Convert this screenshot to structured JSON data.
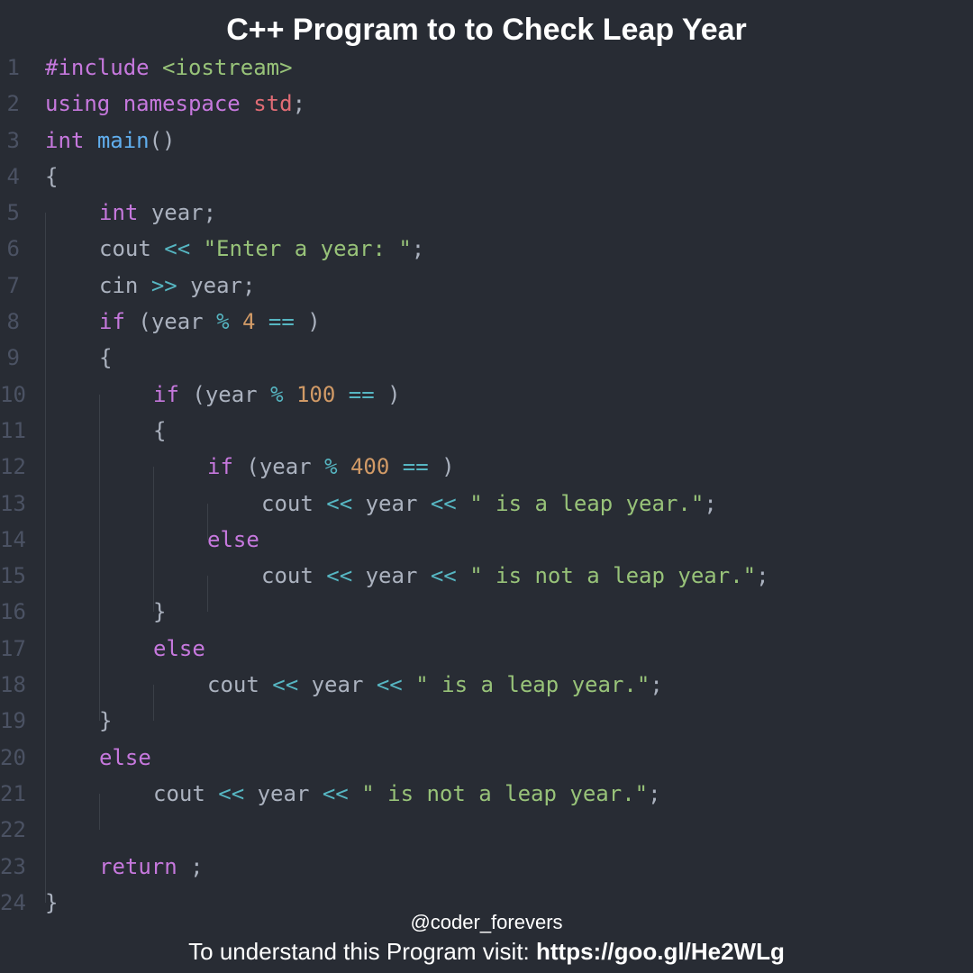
{
  "title": "C++ Program to to Check Leap Year",
  "handle": "@coder_forevers",
  "footer_prefix": "To understand this Program visit: ",
  "footer_link": "https://goo.gl/He2WLg",
  "lines": {
    "l1": {
      "pre": "#include",
      "inc": "<iostream>"
    },
    "l2": {
      "kw1": "using",
      "kw2": "namespace",
      "id": "std",
      "sc": ";"
    },
    "l3": {
      "type": "int",
      "fn": "main",
      "paren": "()"
    },
    "l4": {
      "brace": "{"
    },
    "l5": {
      "type": "int",
      "id": "year",
      "sc": ";"
    },
    "l6": {
      "id": "cout",
      "op": "<<",
      "str": "\"Enter a year: \"",
      "sc": ";"
    },
    "l7": {
      "id1": "cin",
      "op": ">>",
      "id2": "year",
      "sc": ";"
    },
    "l8": {
      "kw": "if",
      "open": "(",
      "id": "year",
      "op1": "%",
      "num": "4",
      "op2": "==",
      "close": ")"
    },
    "l9": {
      "brace": "{"
    },
    "l10": {
      "kw": "if",
      "open": "(",
      "id": "year",
      "op1": "%",
      "num": "100",
      "op2": "==",
      "close": ")"
    },
    "l11": {
      "brace": "{"
    },
    "l12": {
      "kw": "if",
      "open": "(",
      "id": "year",
      "op1": "%",
      "num": "400",
      "op2": "==",
      "close": ")"
    },
    "l13": {
      "id1": "cout",
      "op1": "<<",
      "id2": "year",
      "op2": "<<",
      "str": "\" is a leap year.\"",
      "sc": ";"
    },
    "l14": {
      "kw": "else"
    },
    "l15": {
      "id1": "cout",
      "op1": "<<",
      "id2": "year",
      "op2": "<<",
      "str": "\" is not a leap year.\"",
      "sc": ";"
    },
    "l16": {
      "brace": "}"
    },
    "l17": {
      "kw": "else"
    },
    "l18": {
      "id1": "cout",
      "op1": "<<",
      "id2": "year",
      "op2": "<<",
      "str": "\" is a leap year.\"",
      "sc": ";"
    },
    "l19": {
      "brace": "}"
    },
    "l20": {
      "kw": "else"
    },
    "l21": {
      "id1": "cout",
      "op1": "<<",
      "id2": "year",
      "op2": "<<",
      "str": "\" is not a leap year.\"",
      "sc": ";"
    },
    "l22": {
      "blank": ""
    },
    "l23": {
      "kw": "return",
      "sc": ";"
    },
    "l24": {
      "brace": "}"
    }
  },
  "linenos": [
    "1",
    "2",
    "3",
    "4",
    "5",
    "6",
    "7",
    "8",
    "9",
    "10",
    "11",
    "12",
    "13",
    "14",
    "15",
    "16",
    "17",
    "18",
    "19",
    "20",
    "21",
    "22",
    "23",
    "24"
  ]
}
